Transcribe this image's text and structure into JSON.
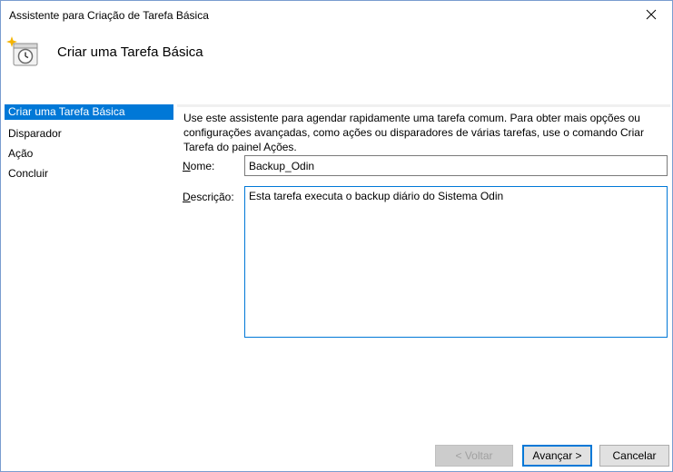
{
  "window": {
    "title": "Assistente para Criação de Tarefa Básica",
    "close_glyph": "✕"
  },
  "header": {
    "title": "Criar uma Tarefa Básica",
    "icon": "task-scheduler-clock-icon"
  },
  "sidebar": {
    "items": [
      {
        "label": "Criar uma Tarefa Básica",
        "active": true
      },
      {
        "label": "Disparador",
        "active": false
      },
      {
        "label": "Ação",
        "active": false
      },
      {
        "label": "Concluir",
        "active": false
      }
    ]
  },
  "main": {
    "intro": "Use este assistente para agendar rapidamente uma tarefa comum. Para obter mais opções ou configurações avançadas, como ações ou disparadores de várias tarefas, use o comando Criar Tarefa do painel Ações.",
    "name_label_first": "N",
    "name_label_rest": "ome:",
    "name_value": "Backup_Odin",
    "desc_label_first": "D",
    "desc_label_rest": "escrição:",
    "desc_value": "Esta tarefa executa o backup diário do Sistema Odin"
  },
  "footer": {
    "back_label": "< Voltar",
    "next_label": "Avançar >",
    "cancel_label": "Cancelar"
  },
  "colors": {
    "accent": "#0078d7",
    "border": "#7a7a7a",
    "button_bg": "#e1e1e1"
  }
}
